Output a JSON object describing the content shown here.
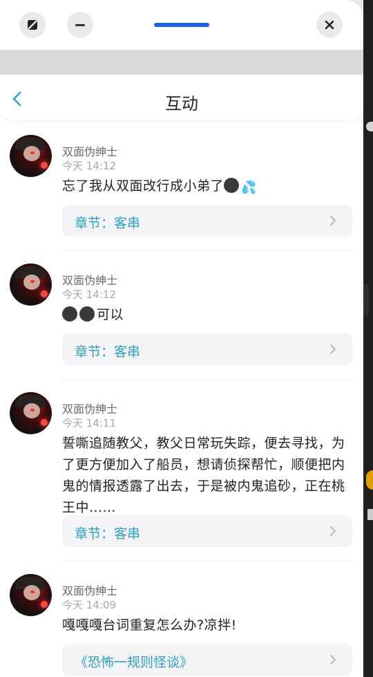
{
  "header": {
    "title": "互动"
  },
  "colors": {
    "accent": "#1a63e0",
    "link": "#2ba0c4"
  },
  "items": [
    {
      "name": "双面伪绅士",
      "time": "今天 14:12",
      "text": "忘了我从双面改行成小弟了",
      "emoji": [
        "dark-face",
        "sweat-drops"
      ],
      "chapter": "章节：客串"
    },
    {
      "name": "双面伪绅士",
      "time": "今天 14:12",
      "text": "可以",
      "emoji": [
        "dark-face",
        "dark-face"
      ],
      "chapter": "章节：客串"
    },
    {
      "name": "双面伪绅士",
      "time": "今天 14:11",
      "text": "誓嘶追随教父，教父日常玩失踪，便去寻找，为了更方便加入了船员，想请侦探帮忙，顺便把内鬼的情报透露了出去，于是被内鬼追砂，正在桃王中……",
      "chapter": "章节：客串"
    },
    {
      "name": "双面伪绅士",
      "time": "今天 14:09",
      "text": "嘎嘎嘎台词重复怎么办?凉拌!",
      "chapter": "《恐怖一规则怪谈》"
    }
  ]
}
